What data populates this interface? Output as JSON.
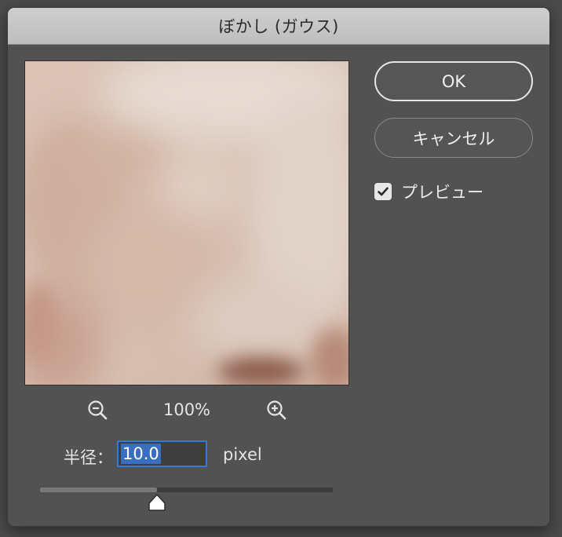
{
  "window": {
    "title": "ぼかし (ガウス)"
  },
  "preview": {
    "zoom_level": "100%",
    "zoom_out_icon": "zoom-out-magnifier",
    "zoom_in_icon": "zoom-in-magnifier"
  },
  "radius": {
    "label": "半径：",
    "value": "10.0",
    "unit": "pixel",
    "slider_fraction": 0.4
  },
  "buttons": {
    "ok_label": "OK",
    "cancel_label": "キャンセル"
  },
  "preview_toggle": {
    "label": "プレビュー",
    "checked": true
  },
  "colors": {
    "selection_blue": "#3a6fc0",
    "focus_ring": "#2f7be0",
    "dialog_bg": "#525252"
  }
}
